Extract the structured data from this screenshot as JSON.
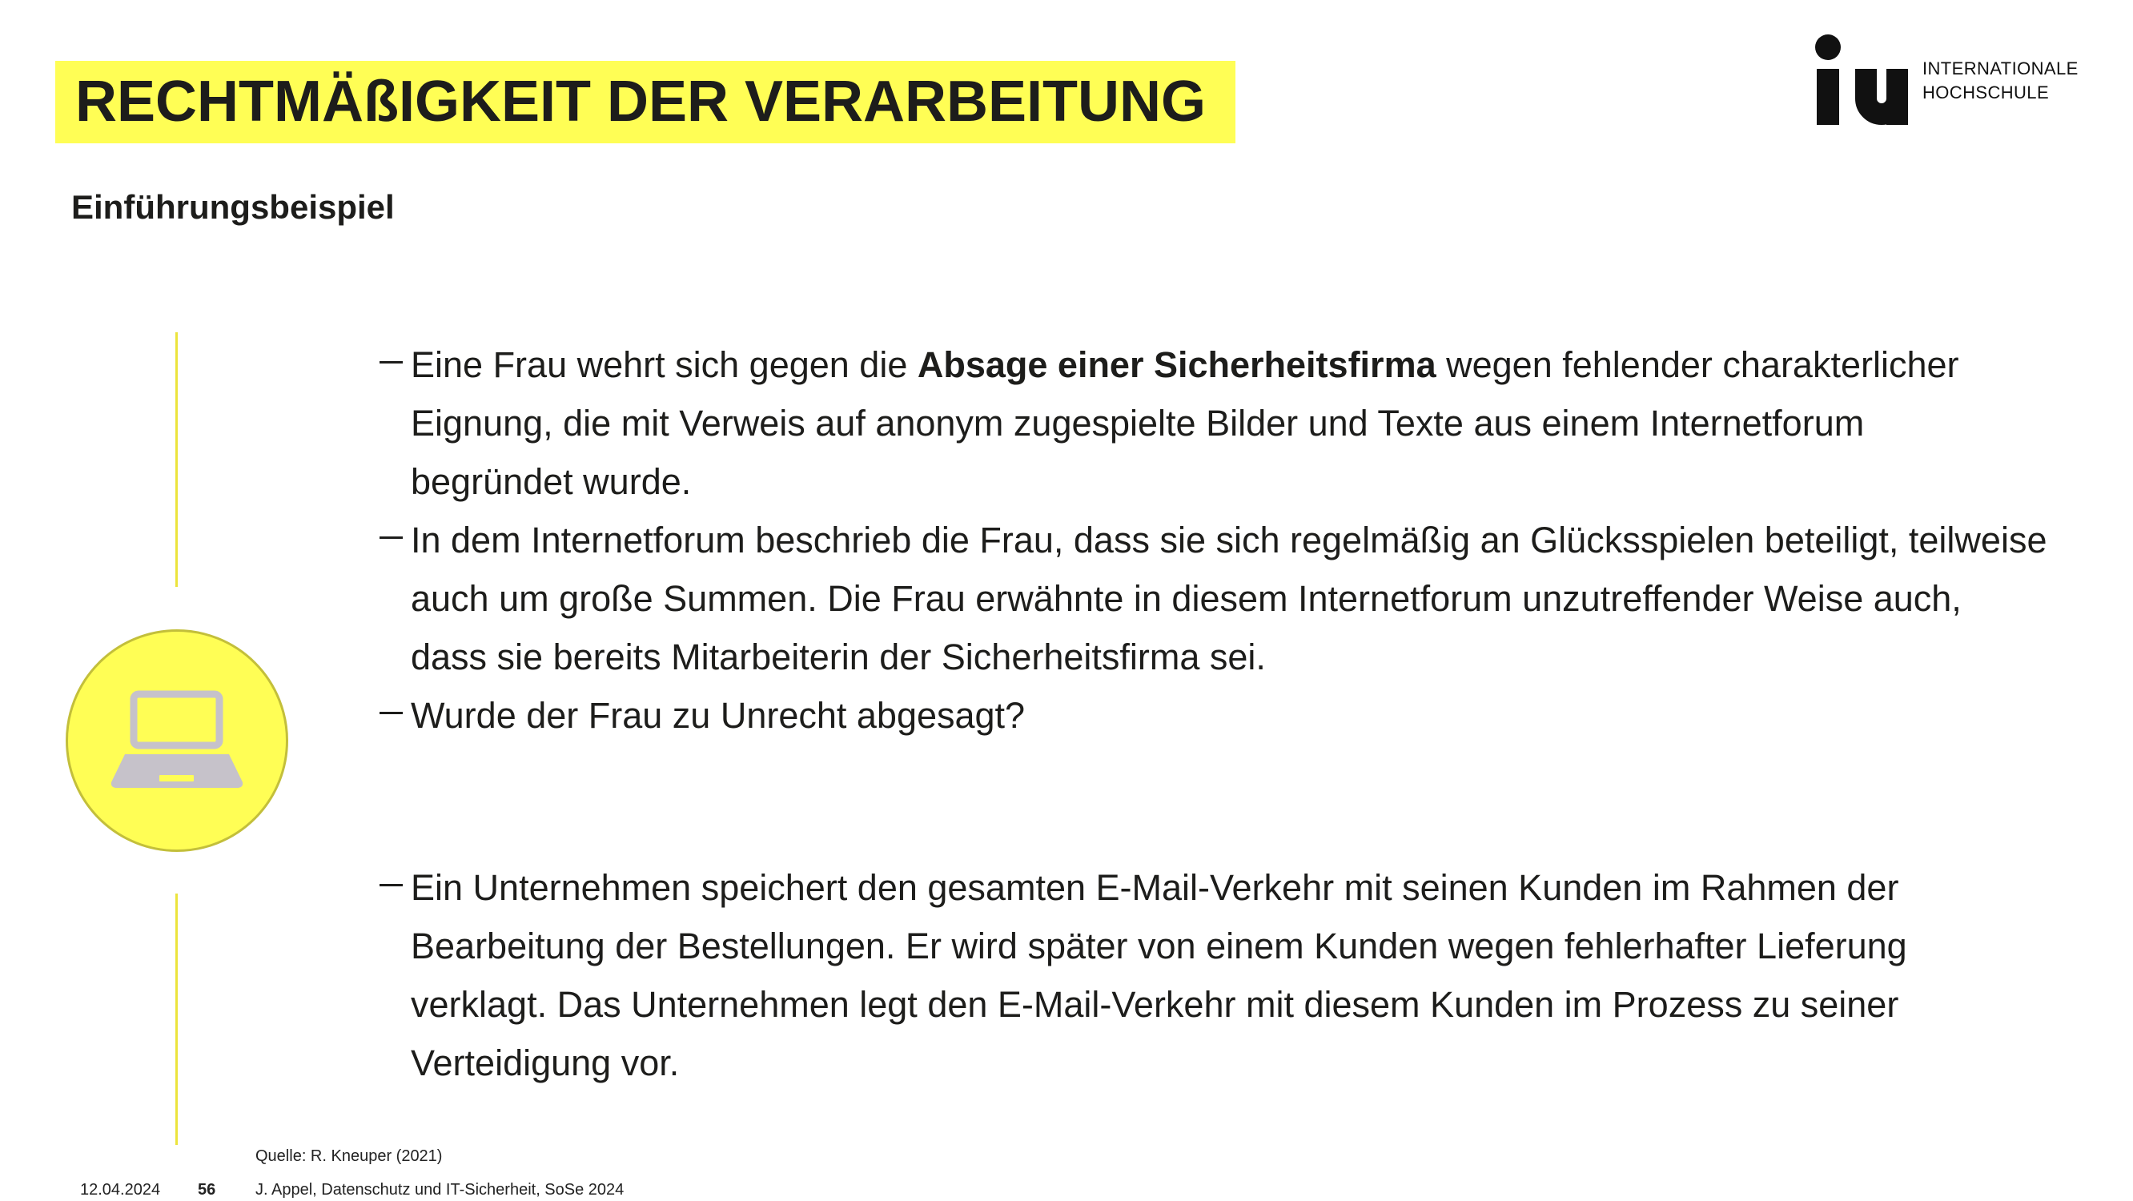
{
  "slide": {
    "title": "RECHTMÄßIGKEIT DER VERARBEITUNG",
    "subtitle": "Einführungsbeispiel"
  },
  "logo": {
    "mark": "iu",
    "line_1": "INTERNATIONALE",
    "line_2": "HOCHSCHULE"
  },
  "badge": {
    "icon": "laptop-icon"
  },
  "bullet_marker": "–",
  "case_1": {
    "bullets": [
      {
        "line_1_start": "Eine Frau wehrt sich gegen die ",
        "line_1_bold": "Absage einer Sicherheitsfirma",
        "line_1_end": " wegen fehlender charakterlicher",
        "lines": [
          "Eignung, die mit Verweis auf anonym zugespielte Bilder und Texte aus einem Internetforum",
          "begründet wurde."
        ]
      },
      {
        "lines": [
          "In dem Internetforum beschrieb die Frau, dass sie sich regelmäßig an Glücksspielen beteiligt, teilweise",
          "auch um große Summen. Die Frau erwähnte in diesem Internetforum unzutreffender Weise auch,",
          "dass sie bereits Mitarbeiterin der Sicherheitsfirma sei."
        ]
      },
      {
        "lines": [
          "Wurde der Frau zu Unrecht abgesagt?"
        ]
      }
    ]
  },
  "case_2": {
    "bullets": [
      {
        "lines": [
          "Ein Unternehmen speichert den gesamten E-Mail-Verkehr mit seinen Kunden im Rahmen der",
          "Bearbeitung der Bestellungen. Er wird später von einem Kunden wegen fehlerhafter Lieferung",
          "verklagt. Das Unternehmen legt den E-Mail-Verkehr mit diesem Kunden im Prozess zu seiner",
          "Verteidigung vor."
        ]
      }
    ]
  },
  "footer": {
    "source": "Quelle: R. Kneuper (2021)",
    "date": "12.04.2024",
    "page_number": "56",
    "course": "J. Appel, Datenschutz und IT-Sicherheit, SoSe 2024"
  },
  "colors": {
    "accent_yellow": "#fffe55",
    "divider_yellow": "#ece43c",
    "badge_border": "#c3bf3a",
    "icon_gray": "#c6c2ca",
    "text": "#1d1d1b"
  }
}
